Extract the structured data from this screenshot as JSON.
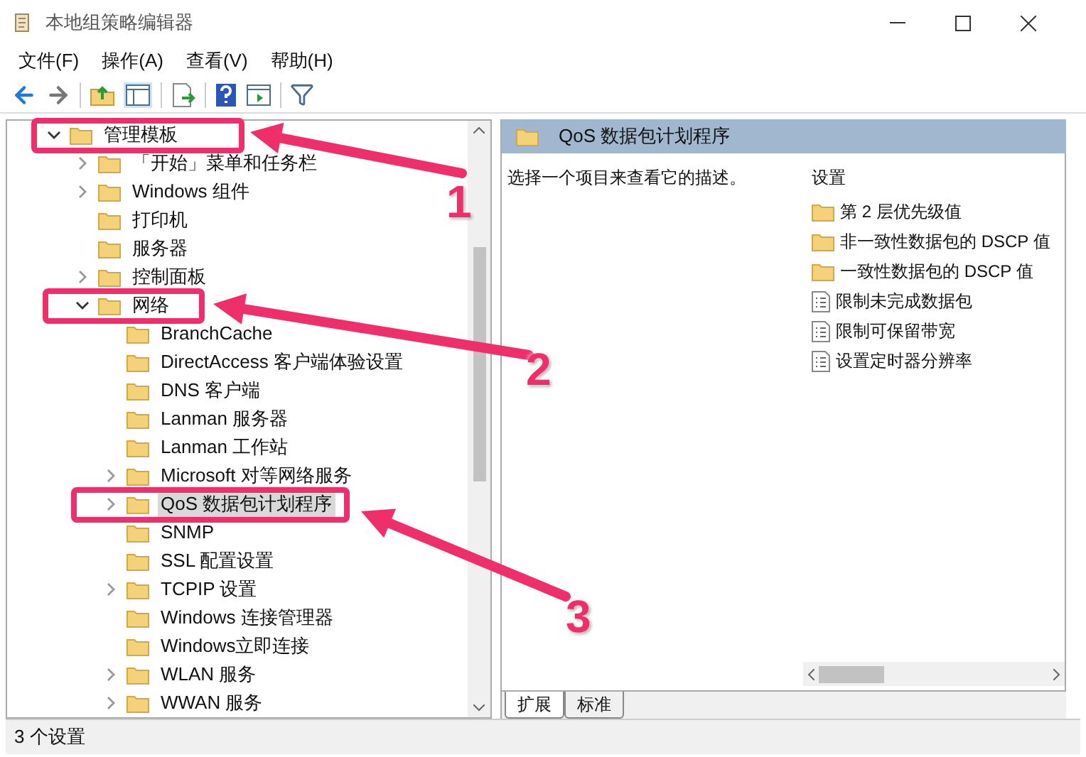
{
  "window": {
    "title": "本地组策略编辑器"
  },
  "menu": [
    "文件(F)",
    "操作(A)",
    "查看(V)",
    "帮助(H)"
  ],
  "tree": {
    "items": [
      {
        "label": "管理模板",
        "has_children": true,
        "expanded": true,
        "selected": false,
        "children": [
          {
            "label": "「开始」菜单和任务栏",
            "has_children": true,
            "expanded": false,
            "selected": false
          },
          {
            "label": "Windows 组件",
            "has_children": true,
            "expanded": false,
            "selected": false
          },
          {
            "label": "打印机",
            "has_children": false,
            "selected": false
          },
          {
            "label": "服务器",
            "has_children": false,
            "selected": false
          },
          {
            "label": "控制面板",
            "has_children": true,
            "expanded": false,
            "selected": false
          },
          {
            "label": "网络",
            "has_children": true,
            "expanded": true,
            "selected": false,
            "children": [
              {
                "label": "BranchCache",
                "has_children": false,
                "selected": false
              },
              {
                "label": "DirectAccess 客户端体验设置",
                "has_children": false,
                "selected": false
              },
              {
                "label": "DNS 客户端",
                "has_children": false,
                "selected": false
              },
              {
                "label": "Lanman 服务器",
                "has_children": false,
                "selected": false
              },
              {
                "label": "Lanman 工作站",
                "has_children": false,
                "selected": false
              },
              {
                "label": "Microsoft 对等网络服务",
                "has_children": true,
                "expanded": false,
                "selected": false
              },
              {
                "label": "QoS 数据包计划程序",
                "has_children": true,
                "expanded": false,
                "selected": true
              },
              {
                "label": "SNMP",
                "has_children": false,
                "selected": false
              },
              {
                "label": "SSL 配置设置",
                "has_children": false,
                "selected": false
              },
              {
                "label": "TCPIP 设置",
                "has_children": true,
                "expanded": false,
                "selected": false
              },
              {
                "label": "Windows 连接管理器",
                "has_children": false,
                "selected": false
              },
              {
                "label": "Windows立即连接",
                "has_children": false,
                "selected": false
              },
              {
                "label": "WLAN 服务",
                "has_children": true,
                "expanded": false,
                "selected": false
              },
              {
                "label": "WWAN 服务",
                "has_children": true,
                "expanded": false,
                "selected": false
              }
            ]
          }
        ]
      }
    ]
  },
  "details": {
    "header": "QoS 数据包计划程序",
    "description": "选择一个项目来查看它的描述。",
    "column": "设置",
    "settings": [
      {
        "kind": "folder",
        "label": "第 2 层优先级值"
      },
      {
        "kind": "folder",
        "label": "非一致性数据包的 DSCP 值"
      },
      {
        "kind": "folder",
        "label": "一致性数据包的 DSCP 值"
      },
      {
        "kind": "policy",
        "label": "限制未完成数据包"
      },
      {
        "kind": "policy",
        "label": "限制可保留带宽"
      },
      {
        "kind": "policy",
        "label": "设置定时器分辨率"
      }
    ]
  },
  "tabs": [
    {
      "label": "扩展",
      "selected": true
    },
    {
      "label": "标准",
      "selected": false
    }
  ],
  "status_bar": "3 个设置",
  "callouts": [
    "1",
    "2",
    "3"
  ]
}
